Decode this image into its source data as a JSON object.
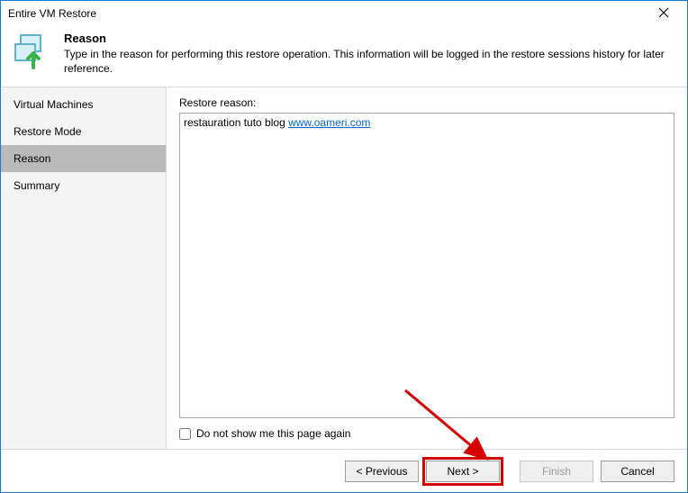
{
  "window": {
    "title": "Entire VM Restore"
  },
  "header": {
    "title": "Reason",
    "description": "Type in the reason for performing this restore operation. This information will be logged in the restore sessions history for later reference."
  },
  "sidebar": {
    "steps": [
      {
        "label": "Virtual Machines",
        "active": false
      },
      {
        "label": "Restore Mode",
        "active": false
      },
      {
        "label": "Reason",
        "active": true
      },
      {
        "label": "Summary",
        "active": false
      }
    ]
  },
  "main": {
    "field_label": "Restore reason:",
    "reason_text": "restauration tuto blog ",
    "reason_link_text": "www.oameri.com",
    "checkbox_label": "Do not show me this page again",
    "checkbox_checked": false
  },
  "footer": {
    "previous": "< Previous",
    "next": "Next >",
    "finish": "Finish",
    "cancel": "Cancel"
  }
}
